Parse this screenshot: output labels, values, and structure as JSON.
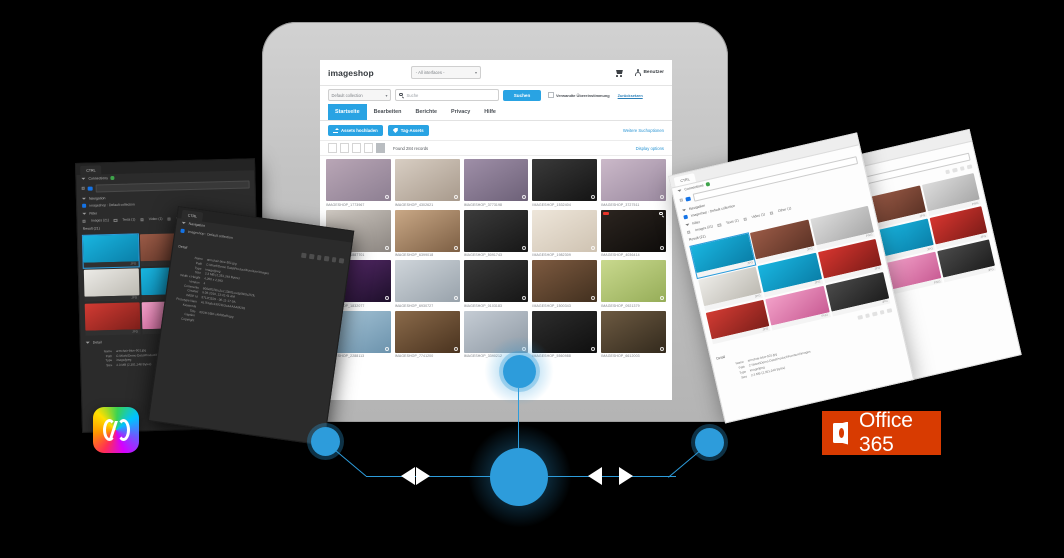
{
  "app": {
    "logo": "imageshop",
    "interface_select": "- All interfaces -",
    "cart_icon": "cart-icon",
    "user_icon": "user-icon",
    "user_label": "Benutzer",
    "collection_select": "Default collection",
    "search_placeholder": "Suche",
    "search_icon": "search-icon",
    "search_button": "Suchen",
    "include_checkbox_label": "Verwandte Übereinstimmung",
    "reset_link": "Zurücksetzen",
    "tabs": [
      {
        "label": "Startseite",
        "active": true
      },
      {
        "label": "Bearbeiten",
        "active": false
      },
      {
        "label": "Berichte",
        "active": false
      },
      {
        "label": "Privacy",
        "active": false
      },
      {
        "label": "Hilfe",
        "active": false
      }
    ],
    "upload_button": "Assets hochladen",
    "upload_icon": "upload-icon",
    "tag_button": "Tag-Assets",
    "tag_icon": "tag-icon",
    "more_search_options": "Weitere Suchoptionen",
    "found_records": "Found 284 records",
    "display_options": "Display options",
    "assets": [
      {
        "caption": "IMAGESHOP_1773967",
        "c1": "#b9a6b6",
        "c2": "#8d7f92"
      },
      {
        "caption": "IMAGESHOP_4302621",
        "c1": "#d8cec3",
        "c2": "#a89a8c"
      },
      {
        "caption": "IMAGESHOP_3773198",
        "c1": "#9f8fa8",
        "c2": "#6d6178"
      },
      {
        "caption": "IMAGESHOP_1532404",
        "c1": "#3a3a3a",
        "c2": "#141414"
      },
      {
        "caption": "IMAGESHOP_3727511",
        "c1": "#cbb9c9",
        "c2": "#9b8aa0"
      },
      {
        "caption": "IMAGESHOP_1887701",
        "c1": "#cfc9c2",
        "c2": "#8b8580"
      },
      {
        "caption": "IMAGESHOP_6399018",
        "c1": "#c9a886",
        "c2": "#7d5f44"
      },
      {
        "caption": "IMAGESHOP_5091743",
        "c1": "#3b3b3b",
        "c2": "#171717"
      },
      {
        "caption": "IMAGESHOP_1982309",
        "c1": "#eee6da",
        "c2": "#cfc3b2"
      },
      {
        "caption": "IMAGESHOP_4036414",
        "c1": "#2c2520",
        "c2": "#0e0c0a"
      },
      {
        "caption": "IMAGESHOP_1832077",
        "c1": "#5b2c6f",
        "c2": "#1d0f2a"
      },
      {
        "caption": "IMAGESHOP_6930727",
        "c1": "#cfd5da",
        "c2": "#98a2ab"
      },
      {
        "caption": "IMAGESHOP_0103183",
        "c1": "#3a3a3a",
        "c2": "#161616"
      },
      {
        "caption": "IMAGESHOP_1500343",
        "c1": "#7d5a40",
        "c2": "#42301f"
      },
      {
        "caption": "IMAGESHOP_0921379",
        "c1": "#c9d98e",
        "c2": "#96ad58"
      },
      {
        "caption": "IMAGESHOP_2288113",
        "c1": "#a8c6d8",
        "c2": "#6c93ad"
      },
      {
        "caption": "IMAGESHOP_7741200",
        "c1": "#8a6a4a",
        "c2": "#4a331f"
      },
      {
        "caption": "IMAGESHOP_3390212",
        "c1": "#c5ccd4",
        "c2": "#8e99a4"
      },
      {
        "caption": "IMAGESHOP_5560988",
        "c1": "#2e2e2e",
        "c2": "#0f0f0f"
      },
      {
        "caption": "IMAGESHOP_6612003",
        "c1": "#6d5a42",
        "c2": "#332a1d"
      }
    ]
  },
  "connector_panel": {
    "tab_label": "CTRL",
    "connections_section": "Connections",
    "connection_name": "imageshop",
    "navigation_section": "Navigation",
    "navigation_value": "imageshop : Default collection",
    "filter_section": "Filter",
    "filter_options": [
      {
        "label": "Images (21)"
      },
      {
        "label": "Texts (1)"
      },
      {
        "label": "Video (1)"
      },
      {
        "label": "Other (1)"
      }
    ],
    "result_section": "Result (21)",
    "assets": [
      {
        "caption": "JPG",
        "c1": "#19b5e0",
        "c2": "#0a7fa8",
        "selected": true
      },
      {
        "caption": "JPG",
        "c1": "#9a5a46",
        "c2": "#5c3326",
        "selected": false
      },
      {
        "caption": "PNG",
        "c1": "#dcdcdc",
        "c2": "#a8a8a8",
        "selected": false
      },
      {
        "caption": "JPG",
        "c1": "#ecebe7",
        "c2": "#bdbab2",
        "selected": false
      },
      {
        "caption": "JPG",
        "c1": "#19b5e0",
        "c2": "#0a7fa8",
        "selected": false
      },
      {
        "caption": "JPG",
        "c1": "#d6352f",
        "c2": "#7e1c18",
        "selected": false
      },
      {
        "caption": "JPG",
        "c1": "#d23b33",
        "c2": "#7d1f1a",
        "selected": false
      },
      {
        "caption": "PNG",
        "c1": "#f2a0c8",
        "c2": "#c95c94",
        "selected": false
      },
      {
        "caption": "JPG",
        "c1": "#4a4a4a",
        "c2": "#1d1d1d",
        "selected": false
      }
    ],
    "metadata_title": "Detail",
    "metadata": [
      {
        "key": "Name",
        "value": "armchair-blue-501.jpg"
      },
      {
        "key": "Path",
        "value": "C:\\Work\\Demo Data\\Product\\Furniture\\Images"
      },
      {
        "key": "Type",
        "value": "image/jpeg"
      },
      {
        "key": "Size",
        "value": "2.3 MB (2,351,248 Bytes)"
      },
      {
        "key": "Width x Height",
        "value": "4,250 x 2,983"
      },
      {
        "key": "Version",
        "value": "4"
      },
      {
        "key": "Comments",
        "value": "600x6f1f1bc2cc:13b01ccdg6bb5c2f2fc"
      },
      {
        "key": "Created",
        "value": "8.08.2019, 13:41:41 AM"
      },
      {
        "key": "IMGP Id",
        "value": "5712f1529 - 06-11-17-9A"
      },
      {
        "key": "Prototype Nam",
        "value": "AL7f4a9c19921b3cAAAAAM233"
      },
      {
        "key": "Keywords",
        "value": ""
      },
      {
        "key": "Title",
        "value": "0924f-b5bf-c4bf3bafh.jpg"
      },
      {
        "key": "Caption",
        "value": ""
      },
      {
        "key": "Copyright",
        "value": ""
      }
    ]
  },
  "overlay_badges": {
    "creative_cloud": "creative-cloud-logo",
    "office365_label": "Office 365",
    "office365_icon": "office-logo-icon",
    "office365_color": "#d83b01"
  },
  "diagram": {
    "accent_color": "#2d9cdb",
    "arrow_color": "#ffffff",
    "nodes": [
      "node-left",
      "node-center",
      "node-right"
    ]
  }
}
